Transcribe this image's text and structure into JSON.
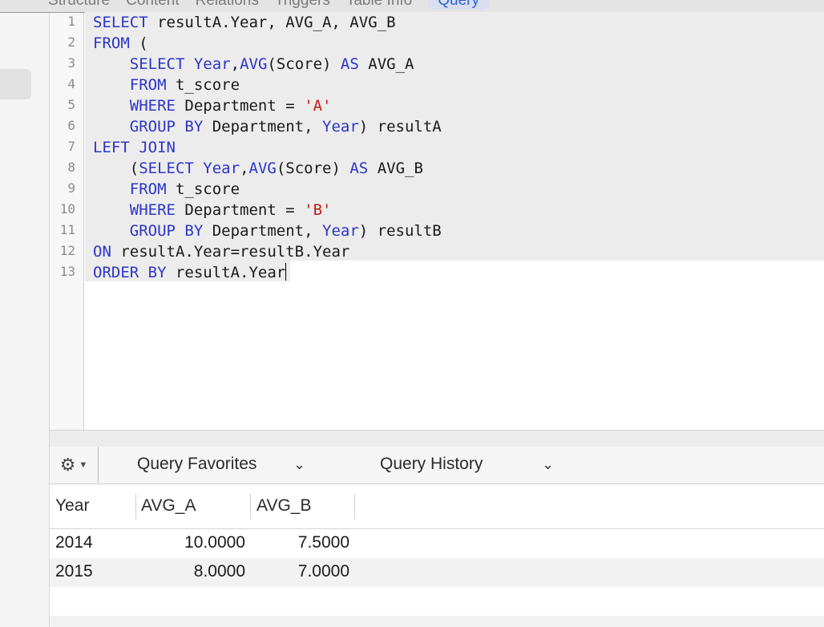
{
  "tabs": [
    "Structure",
    "Content",
    "Relations",
    "Triggers",
    "Table Info",
    "Query"
  ],
  "editor": {
    "line_numbers": [
      "1",
      "2",
      "3",
      "4",
      "5",
      "6",
      "7",
      "8",
      "9",
      "10",
      "11",
      "12",
      "13"
    ]
  },
  "toolbar": {
    "favorites_label": "Query Favorites",
    "history_label": "Query History"
  },
  "results": {
    "columns": [
      "Year",
      "AVG_A",
      "AVG_B"
    ],
    "rows": [
      [
        "2014",
        "10.0000",
        "7.5000"
      ],
      [
        "2015",
        "8.0000",
        "7.0000"
      ]
    ]
  },
  "colors": {
    "keyword": "#2c35c8",
    "string": "#c41a16",
    "active_tab": "#2a62d8"
  }
}
